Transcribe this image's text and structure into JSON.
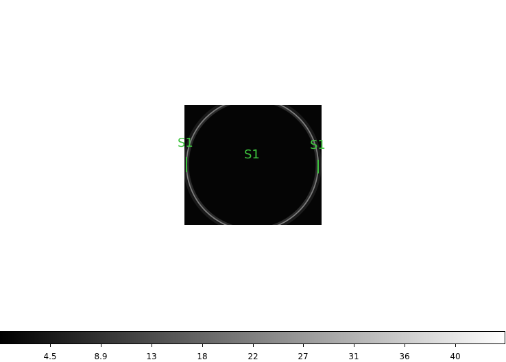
{
  "image": {
    "region_labels": [
      {
        "text": "S1"
      },
      {
        "text": "S1"
      },
      {
        "text": "S1"
      }
    ]
  },
  "colorbar": {
    "colormap": "grey",
    "ticks": [
      "4.5",
      "8.9",
      "13",
      "18",
      "22",
      "27",
      "31",
      "36",
      "40"
    ]
  },
  "colors": {
    "region": "#3ec43e",
    "background": "#ffffff",
    "image_background": "#050505"
  }
}
